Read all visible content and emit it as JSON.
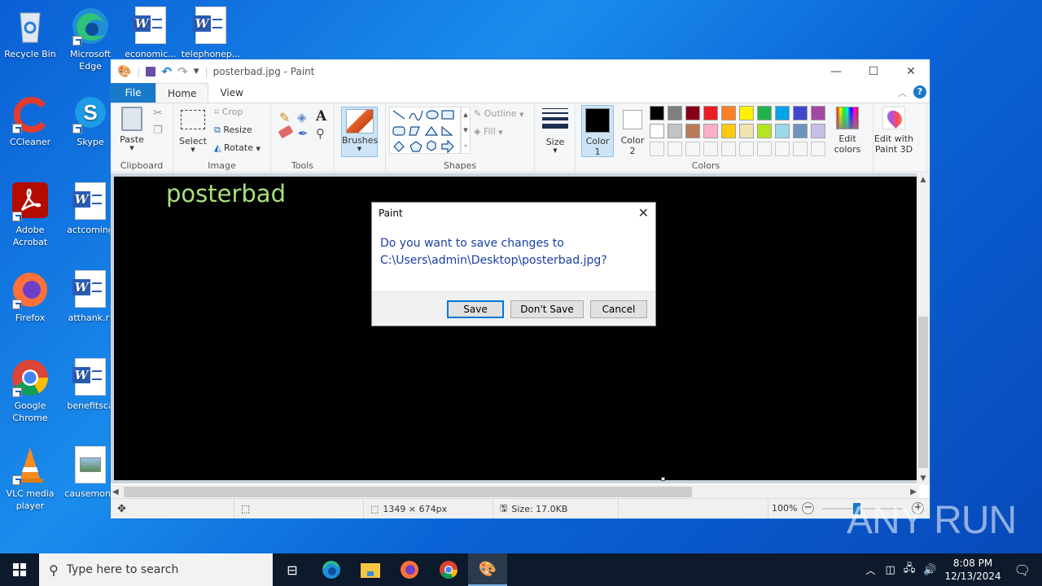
{
  "desktop": {
    "icons": [
      {
        "label": "Recycle Bin",
        "icon": "recycle-bin-icon"
      },
      {
        "label": "Microsoft Edge",
        "icon": "edge-icon"
      },
      {
        "label": "economic...",
        "icon": "word-doc-icon"
      },
      {
        "label": "telephonep...",
        "icon": "word-doc-icon"
      },
      {
        "label": "CCleaner",
        "icon": "ccleaner-icon"
      },
      {
        "label": "Skype",
        "icon": "skype-icon"
      },
      {
        "label": "Adobe Acrobat",
        "icon": "acrobat-icon"
      },
      {
        "label": "actcoming",
        "icon": "word-doc-icon"
      },
      {
        "label": "Firefox",
        "icon": "firefox-icon"
      },
      {
        "label": "atthank.rt",
        "icon": "word-doc-icon"
      },
      {
        "label": "Google Chrome",
        "icon": "chrome-icon"
      },
      {
        "label": "benefitsca",
        "icon": "word-doc-icon"
      },
      {
        "label": "VLC media player",
        "icon": "vlc-icon"
      },
      {
        "label": "causemone",
        "icon": "image-file-icon"
      }
    ]
  },
  "paint": {
    "title": "posterbad.jpg - Paint",
    "tabs": {
      "file": "File",
      "home": "Home",
      "view": "View"
    },
    "ribbon": {
      "clipboard": {
        "paste": "Paste",
        "group": "Clipboard"
      },
      "image": {
        "select": "Select",
        "crop": "Crop",
        "resize": "Resize",
        "rotate": "Rotate",
        "group": "Image"
      },
      "tools": {
        "group": "Tools"
      },
      "brushes": "Brushes",
      "shapes": {
        "outline": "Outline",
        "fill": "Fill",
        "group": "Shapes"
      },
      "size": "Size",
      "color1": "Color 1",
      "color2": "Color 2",
      "colors": {
        "group": "Colors",
        "row1": [
          "#000000",
          "#7f7f7f",
          "#880015",
          "#ed1c24",
          "#ff7f27",
          "#fff200",
          "#22b14c",
          "#00a2e8",
          "#3f48cc",
          "#a349a4"
        ],
        "row2": [
          "#ffffff",
          "#c3c3c3",
          "#b97a57",
          "#ffaec9",
          "#ffc90e",
          "#efe4b0",
          "#b5e61d",
          "#99d9ea",
          "#7092be",
          "#c8bfe7"
        ]
      },
      "edit_colors": "Edit colors",
      "edit_paint3d": "Edit with Paint 3D"
    },
    "canvas_text": "posterbad",
    "status": {
      "dimensions": "1349 × 674px",
      "size": "Size: 17.0KB",
      "zoom": "100%"
    }
  },
  "dialog": {
    "title": "Paint",
    "message_line1": "Do you want to save changes to",
    "message_line2": "C:\\Users\\admin\\Desktop\\posterbad.jpg?",
    "save": "Save",
    "dont_save": "Don't Save",
    "cancel": "Cancel"
  },
  "taskbar": {
    "search_placeholder": "Type here to search",
    "time": "8:08 PM",
    "date": "12/13/2024"
  },
  "watermark": "ANY RUN"
}
